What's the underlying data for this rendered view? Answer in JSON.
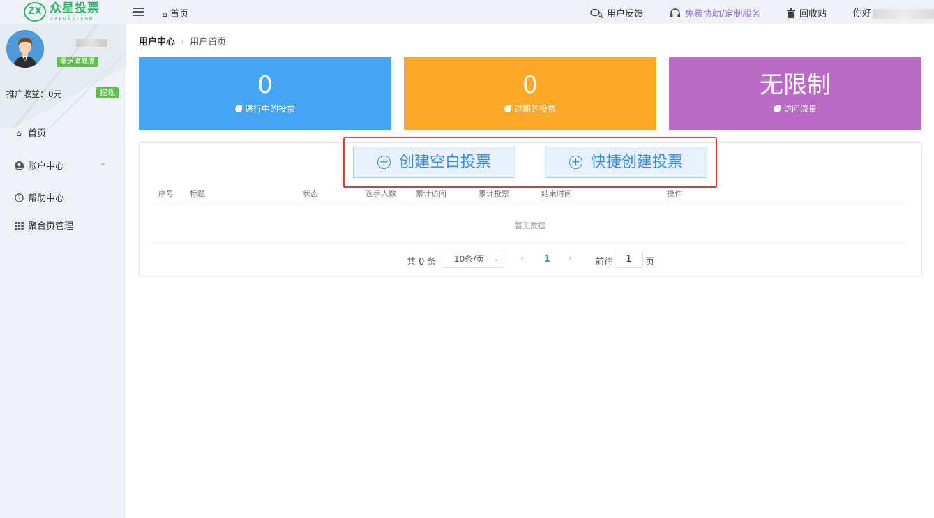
{
  "logo": {
    "mark": "ZX",
    "title": "众星投票",
    "subtitle": "zxpoll.com"
  },
  "topbar": {
    "home_label": "首页",
    "feedback_label": "用户反馈",
    "service_label": "免费协助/定制服务",
    "recycle_label": "回收站",
    "greeting_label": "你好"
  },
  "sidebar": {
    "edition_badge": "赠送旗舰版",
    "promo_label": "推广收益：0元",
    "withdraw_label": "提现",
    "items": [
      {
        "label": "首页",
        "icon": "home-icon"
      },
      {
        "label": "账户中心",
        "icon": "user-circle-icon"
      },
      {
        "label": "帮助中心",
        "icon": "question-circle-icon"
      },
      {
        "label": "聚合页管理",
        "icon": "grid-icon"
      }
    ]
  },
  "breadcrumb": {
    "current": "用户中心",
    "page": "用户首页"
  },
  "stats": [
    {
      "value": "0",
      "label": "进行中的投票",
      "color": "#44a5f4"
    },
    {
      "value": "0",
      "label": "过期的投票",
      "color": "#fca92a"
    },
    {
      "value": "无限制",
      "label": "访问流量",
      "color": "#b96bc6"
    }
  ],
  "actions": {
    "create_blank": "创建空白投票",
    "quick_create": "快捷创建投票"
  },
  "table": {
    "columns": [
      "序号",
      "标题",
      "状态",
      "选手人数",
      "累计访问",
      "累计投票",
      "结束时间",
      "操作"
    ],
    "empty_text": "暂无数据"
  },
  "pagination": {
    "total": "共 0 条",
    "page_size": "10条/页",
    "current_page": "1",
    "goto_label": "前往",
    "goto_value": "1",
    "page_suffix": "页"
  },
  "colors": {
    "brand": "#2fb56c",
    "accent": "#3d8fe0",
    "highlight": "#e53935"
  }
}
